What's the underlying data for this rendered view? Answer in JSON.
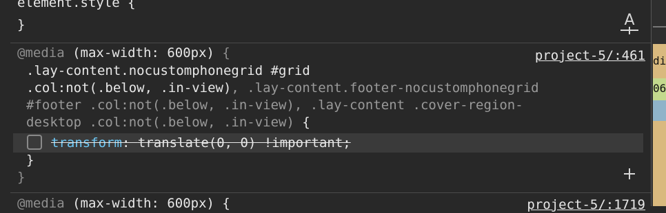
{
  "rules": [
    {
      "selector": "element.style {",
      "close": "}"
    },
    {
      "media": "@media",
      "media_query": " (max-width: 600px) ",
      "media_brace": "{",
      "source": "project-5/:461",
      "selector_active_1": ".lay-content.nocustomphonegrid #grid",
      "selector_active_2": ".col:not(.below, .in-view)",
      "selector_rest_2": ", .lay-content.footer-nocustomphonegrid",
      "selector_line_3": "#footer .col:not(.below, .in-view), .lay-content .cover-region-",
      "selector_line_4": "desktop .col:not(.below, .in-view)",
      "open_brace": " {",
      "declaration": {
        "property": "transform",
        "colon": ": ",
        "value": "translate(0, 0) !important;",
        "enabled": false
      },
      "close": "}",
      "media_close": "}"
    },
    {
      "media": "@media",
      "media_query": " (max-width: 600px) {",
      "source": "project-5/:1719"
    }
  ],
  "side_strip": {
    "text_1": "din",
    "text_2": "06"
  },
  "colors": {
    "background": "#282828",
    "property": "#6ec8f5",
    "dim": "#8f8f8f"
  },
  "icons": {
    "text_icon": "text-format-icon",
    "add_icon": "plus-icon"
  }
}
